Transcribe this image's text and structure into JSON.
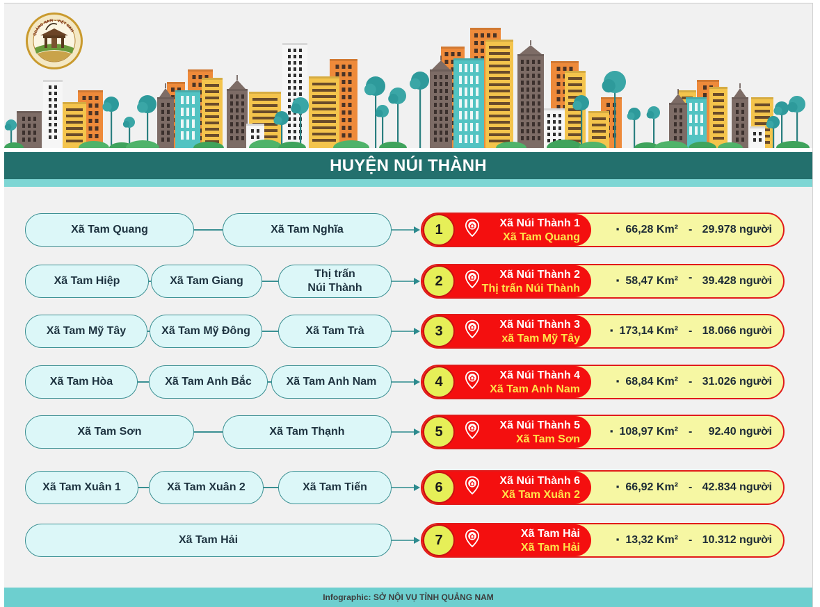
{
  "logo": {
    "text": "QUẢNG NAM - VIỆT NAM"
  },
  "title": "HUYỆN NÚI THÀNH",
  "bullet_char": "▪",
  "rows": [
    {
      "number": "1",
      "sources": [
        "Xã Tam Quang",
        "Xã Tam Nghĩa"
      ],
      "new_name": "Xã Núi Thành 1",
      "center": "Xã Tam Quang",
      "area": "66,28 Km²",
      "separator": "-",
      "population": "29.978 người"
    },
    {
      "number": "2",
      "sources": [
        "Xã Tam Hiệp",
        "Xã Tam Giang",
        "Thị trấn Núi Thành"
      ],
      "new_name": "Xã Núi Thành 2",
      "center": "Thị trấn Núi Thành",
      "area": "58,47 Km²",
      "separator": "-",
      "population": "39.428 người"
    },
    {
      "number": "3",
      "sources": [
        "Xã Tam Mỹ Tây",
        "Xã Tam Mỹ Đông",
        "Xã Tam Trà"
      ],
      "new_name": "Xã Núi Thành 3",
      "center": "xã Tam Mỹ Tây",
      "area": "173,14 Km²",
      "separator": "-",
      "population": "18.066 người"
    },
    {
      "number": "4",
      "sources": [
        "Xã Tam Hòa",
        "Xã Tam Anh Bắc",
        "Xã Tam Anh Nam"
      ],
      "new_name": "Xã Núi Thành 4",
      "center": "Xã Tam Anh Nam",
      "area": "68,84 Km²",
      "separator": "-",
      "population": "31.026 người"
    },
    {
      "number": "5",
      "sources": [
        "Xã Tam Sơn",
        "Xã Tam Thạnh"
      ],
      "new_name": "Xã Núi Thành 5",
      "center": "Xã Tam Sơn",
      "area": "108,97 Km²",
      "separator": "-",
      "population": "92.40 người"
    },
    {
      "number": "6",
      "sources": [
        "Xã Tam Xuân 1",
        "Xã Tam Xuân 2",
        "Xã Tam Tiến"
      ],
      "new_name": "Xã Núi Thành 6",
      "center": "Xã Tam Xuân 2",
      "area": "66,92 Km²",
      "separator": "-",
      "population": "42.834 người"
    },
    {
      "number": "7",
      "sources": [
        "Xã Tam Hải"
      ],
      "new_name": "Xã Tam Hải",
      "center": "Xã Tam Hải",
      "area": "13,32 Km²",
      "separator": "-",
      "population": "10.312 người"
    }
  ],
  "footer": "Infographic: SỞ NỘI VỤ TỈNH QUẢNG NAM",
  "colors": {
    "title_bar": "#23706d",
    "accent_light": "#7ed6d4",
    "panel_red": "#f40f0f",
    "panel_yellow": "#f6f7a3",
    "badge": "#e6ef58",
    "pill_fill": "#dcf7f8",
    "pill_border": "#3a8f92",
    "footer": "#6dcfcf"
  }
}
